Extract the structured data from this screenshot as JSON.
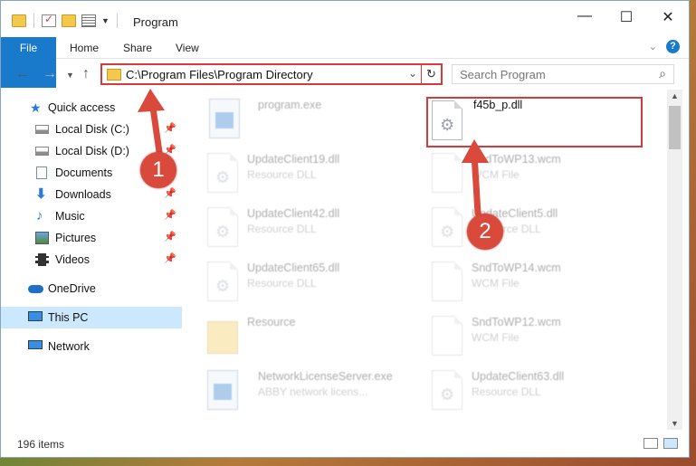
{
  "titlebar": {
    "title": "Program",
    "min_glyph": "—",
    "max_glyph": "☐",
    "close_glyph": "✕"
  },
  "ribbon": {
    "tabs": [
      "File",
      "Home",
      "Share",
      "View"
    ],
    "help": "?"
  },
  "address": {
    "path": "C:\\Program Files\\Program Directory",
    "search_placeholder": "Search Program"
  },
  "nav": {
    "items": [
      {
        "label": "Quick access",
        "icon": "star-icon",
        "pinned": false
      },
      {
        "label": "Local Disk (C:)",
        "icon": "disk-icon",
        "pinned": true
      },
      {
        "label": "Local Disk (D:)",
        "icon": "disk-icon",
        "pinned": true
      },
      {
        "label": "Documents",
        "icon": "documents-icon",
        "pinned": true
      },
      {
        "label": "Downloads",
        "icon": "download-icon",
        "pinned": true
      },
      {
        "label": "Music",
        "icon": "music-icon",
        "pinned": true
      },
      {
        "label": "Pictures",
        "icon": "pictures-icon",
        "pinned": true
      },
      {
        "label": "Videos",
        "icon": "videos-icon",
        "pinned": true
      },
      {
        "label": "OneDrive",
        "icon": "onedrive-icon",
        "pinned": false
      },
      {
        "label": "This PC",
        "icon": "pc-icon",
        "pinned": false,
        "selected": true
      },
      {
        "label": "Network",
        "icon": "network-icon",
        "pinned": false
      }
    ]
  },
  "files": [
    {
      "name": "program.exe",
      "type": "",
      "icon": "exe-icon"
    },
    {
      "name": "f45b_p.dll",
      "type": "",
      "icon": "dll-icon"
    },
    {
      "name": "UpdateClient19.dll",
      "type": "Resource DLL",
      "icon": "dll-icon"
    },
    {
      "name": "SndToWP13.wcm",
      "type": "WCM File",
      "icon": "file-icon"
    },
    {
      "name": "UpdateClient42.dll",
      "type": "Resource DLL",
      "icon": "dll-icon"
    },
    {
      "name": "UpdateClient5.dll",
      "type": "Resource DLL",
      "icon": "dll-icon"
    },
    {
      "name": "UpdateClient65.dll",
      "type": "Resource DLL",
      "icon": "dll-icon"
    },
    {
      "name": "SndToWP14.wcm",
      "type": "WCM File",
      "icon": "file-icon"
    },
    {
      "name": "Resource",
      "type": "",
      "icon": "folder-icon"
    },
    {
      "name": "SndToWP12.wcm",
      "type": "WCM File",
      "icon": "file-icon"
    },
    {
      "name": "NetworkLicenseServer.exe",
      "type": "ABBY network licens...",
      "icon": "exe-icon"
    },
    {
      "name": "UpdateClient63.dll",
      "type": "Resource DLL",
      "icon": "dll-icon"
    }
  ],
  "status": {
    "count": "196 items"
  },
  "annotations": {
    "step1": "1",
    "step2": "2",
    "color": "#d94a3d"
  }
}
